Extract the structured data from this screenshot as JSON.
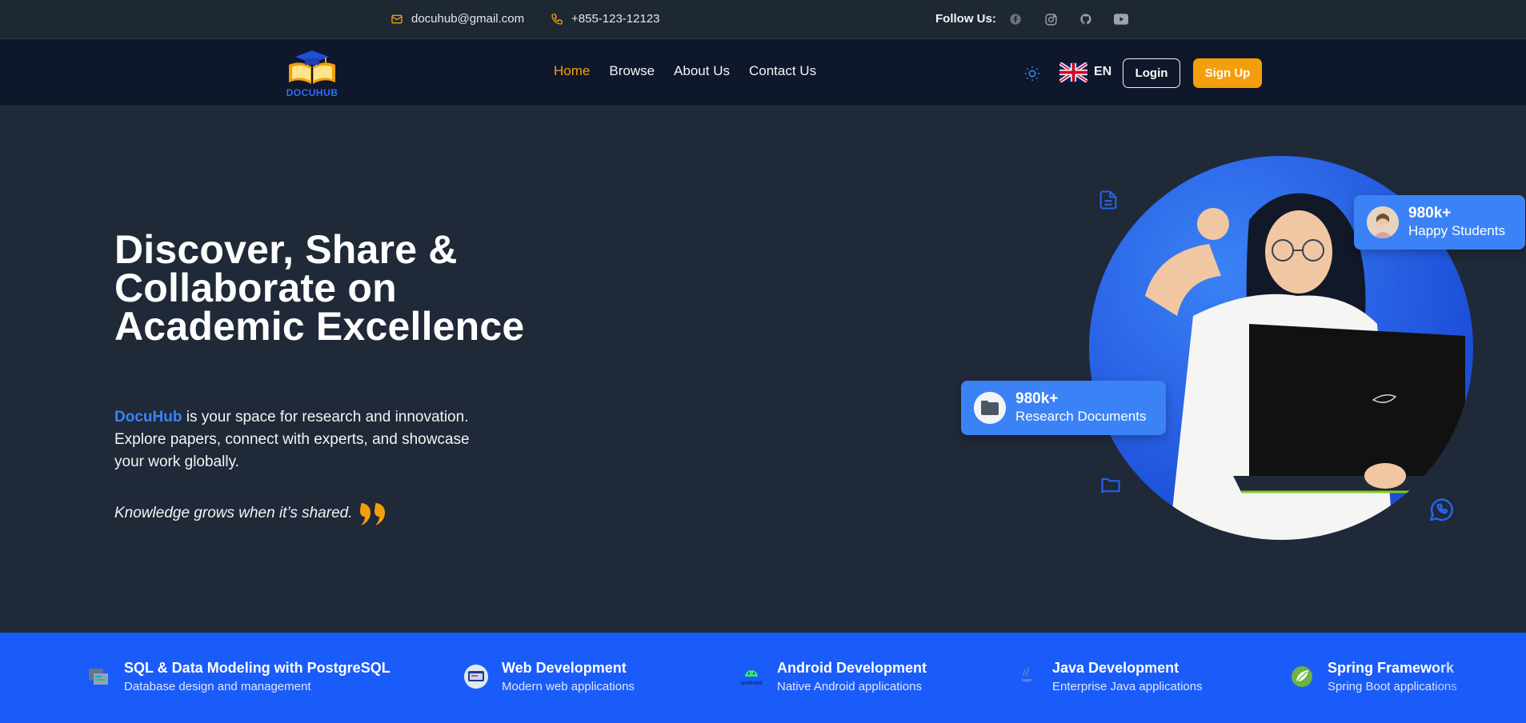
{
  "topbar": {
    "email": "docuhub@gmail.com",
    "phone": "+855-123-12123",
    "follow_label": "Follow Us:",
    "social": [
      "facebook-icon",
      "instagram-icon",
      "github-icon",
      "youtube-icon"
    ]
  },
  "nav": {
    "logo_text": "DOCUHUB",
    "links": [
      {
        "label": "Home",
        "active": true
      },
      {
        "label": "Browse",
        "active": false
      },
      {
        "label": "About Us",
        "active": false
      },
      {
        "label": "Contact Us",
        "active": false
      }
    ],
    "language": "EN",
    "login_label": "Login",
    "signup_label": "Sign Up"
  },
  "hero": {
    "title": "Discover, Share & Collaborate on Academic Excellence",
    "brand": "DocuHub",
    "description": " is your space for research and innovation. Explore papers, connect with experts, and showcase your work globally.",
    "quote": "Knowledge grows when it’s shared.",
    "stats": [
      {
        "number": "980k+",
        "label": "Happy Students"
      },
      {
        "number": "980k+",
        "label": "Research Documents"
      }
    ]
  },
  "categories": [
    {
      "title": "SQL & Data Modeling with PostgreSQL",
      "subtitle": "Database design and management"
    },
    {
      "title": "Web Development",
      "subtitle": "Modern web applications"
    },
    {
      "title": "Android Development",
      "subtitle": "Native Android applications"
    },
    {
      "title": "Java Development",
      "subtitle": "Enterprise Java applications"
    },
    {
      "title": "Spring Framework",
      "subtitle": "Spring Boot applications"
    }
  ],
  "colors": {
    "accent": "#f59e0b",
    "primary": "#3b82f6",
    "strip": "#1a5cfa",
    "background": "#1f2937",
    "nav": "#0f172a"
  }
}
